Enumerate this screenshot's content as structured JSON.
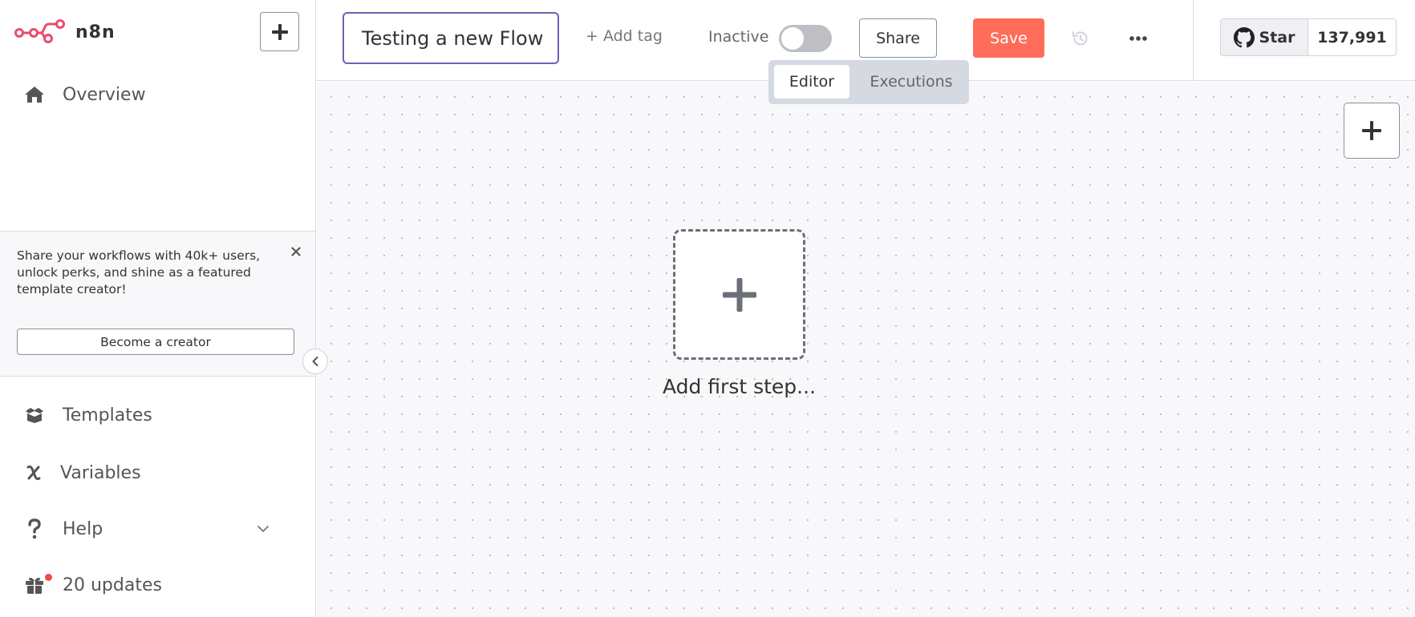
{
  "app": {
    "name": "n8n",
    "brand_color": "#ea4b71"
  },
  "sidebar": {
    "add_button_icon": "plus-icon",
    "nav": {
      "overview": {
        "label": "Overview",
        "icon": "home-icon"
      },
      "templates": {
        "label": "Templates",
        "icon": "box-open-icon"
      },
      "variables": {
        "label": "Variables",
        "icon": "variable-x-icon"
      },
      "help": {
        "label": "Help",
        "icon": "question-icon"
      },
      "updates": {
        "label": "20 updates",
        "icon": "gift-icon"
      }
    },
    "promo": {
      "text": "Share your workflows with 40k+ users, unlock perks, and shine as a featured template creator!",
      "button_label": "Become a creator"
    }
  },
  "header": {
    "workflow_name": "Testing a new Flow",
    "add_tag_label": "+ Add tag",
    "status_label": "Inactive",
    "active": false,
    "share_label": "Share",
    "save_label": "Save",
    "save_color": "#ff6d5a",
    "github": {
      "star_label": "Star",
      "star_count": "137,991"
    }
  },
  "tabs": [
    {
      "label": "Editor",
      "active": true
    },
    {
      "label": "Executions",
      "active": false
    }
  ],
  "canvas": {
    "add_first_step_label": "Add first step..."
  }
}
